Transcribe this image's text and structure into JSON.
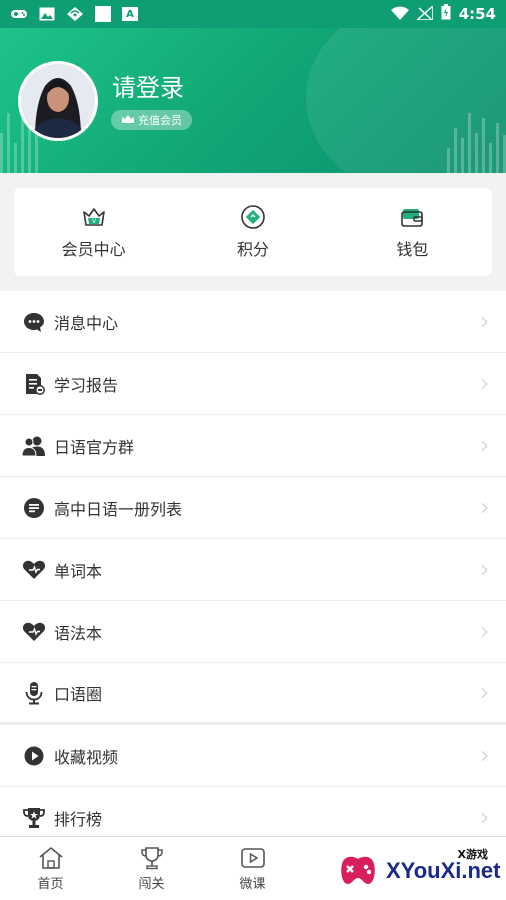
{
  "status_bar": {
    "time": "4:54",
    "notif_icons": [
      "gamepad-icon",
      "image-icon",
      "signal-badge-icon",
      "blank-icon",
      "a-icon"
    ],
    "a_letter": "A"
  },
  "header": {
    "login_text": "请登录",
    "vip_button": "充值会员",
    "accent": "#12a877"
  },
  "quick_links": [
    {
      "label": "会员中心",
      "icon": "crown-icon"
    },
    {
      "label": "积分",
      "icon": "points-icon"
    },
    {
      "label": "钱包",
      "icon": "wallet-icon"
    }
  ],
  "menu": [
    {
      "label": "消息中心",
      "icon": "message-icon"
    },
    {
      "label": "学习报告",
      "icon": "report-icon"
    },
    {
      "label": "日语官方群",
      "icon": "group-icon"
    },
    {
      "label": "高中日语一册列表",
      "icon": "list-icon"
    },
    {
      "label": "单词本",
      "icon": "heart-icon"
    },
    {
      "label": "语法本",
      "icon": "heart-icon"
    },
    {
      "label": "口语圈",
      "icon": "microphone-icon"
    },
    {
      "label": "收藏视频",
      "icon": "play-icon"
    },
    {
      "label": "排行榜",
      "icon": "trophy-icon"
    }
  ],
  "tabs": [
    {
      "label": "首页",
      "icon": "home-icon"
    },
    {
      "label": "闯关",
      "icon": "trophy-icon"
    },
    {
      "label": "微课",
      "icon": "video-icon"
    }
  ],
  "watermark": {
    "main": "XYouXi.net",
    "sub": "X游戏"
  }
}
